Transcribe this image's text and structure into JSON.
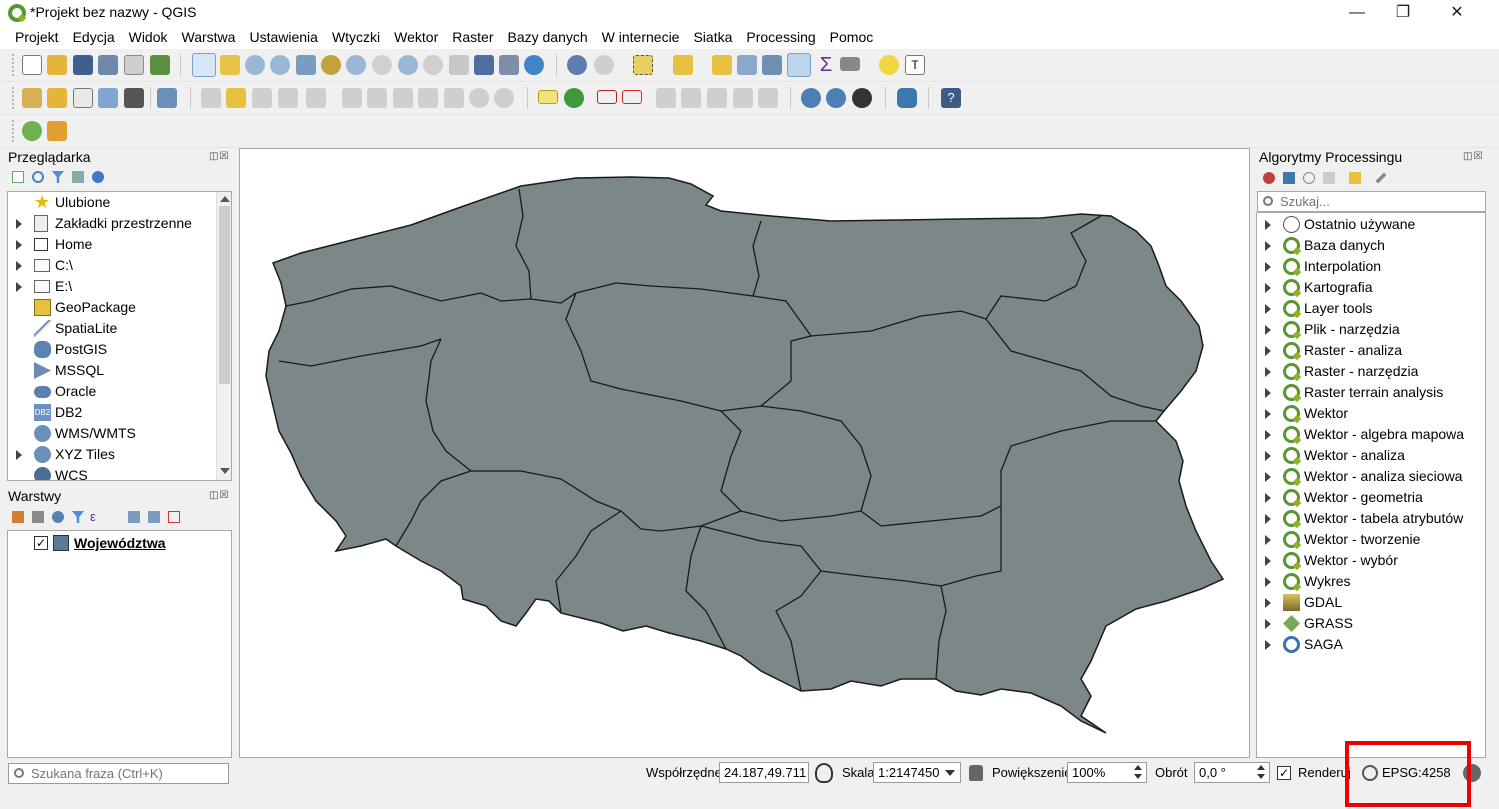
{
  "window": {
    "title": "*Projekt bez nazwy - QGIS",
    "minimize": "—",
    "maximize": "❐",
    "close": "✕"
  },
  "menu": [
    "Projekt",
    "Edycja",
    "Widok",
    "Warstwa",
    "Ustawienia",
    "Wtyczki",
    "Wektor",
    "Raster",
    "Bazy danych",
    "W internecie",
    "Siatka",
    "Processing",
    "Pomoc"
  ],
  "browser": {
    "title": "Przeglądarka",
    "dock_buttons": "◫☒",
    "items": [
      {
        "label": "Ulubione",
        "icon": "star-icon",
        "expandable": false
      },
      {
        "label": "Zakładki przestrzenne",
        "icon": "bookmark-icon",
        "expandable": true
      },
      {
        "label": "Home",
        "icon": "home-icon",
        "expandable": true
      },
      {
        "label": "C:\\",
        "icon": "folder-icon",
        "expandable": true
      },
      {
        "label": "E:\\",
        "icon": "folder-icon",
        "expandable": true
      },
      {
        "label": "GeoPackage",
        "icon": "geopackage-icon",
        "expandable": false
      },
      {
        "label": "SpatiaLite",
        "icon": "spatialite-icon",
        "expandable": false
      },
      {
        "label": "PostGIS",
        "icon": "postgis-icon",
        "expandable": false
      },
      {
        "label": "MSSQL",
        "icon": "mssql-icon",
        "expandable": false
      },
      {
        "label": "Oracle",
        "icon": "oracle-icon",
        "expandable": false
      },
      {
        "label": "DB2",
        "icon": "db2-icon",
        "expandable": false
      },
      {
        "label": "WMS/WMTS",
        "icon": "globe-icon",
        "expandable": false
      },
      {
        "label": "XYZ Tiles",
        "icon": "globe-icon",
        "expandable": true
      },
      {
        "label": "WCS",
        "icon": "globe-icon",
        "expandable": false
      }
    ]
  },
  "layers": {
    "title": "Warstwy",
    "dock_buttons": "◫☒",
    "items": [
      {
        "label": "Województwa",
        "checked": true,
        "check_glyph": "✓",
        "color": "#5b7a99"
      }
    ]
  },
  "processing": {
    "title": "Algorytmy Processingu",
    "dock_buttons": "◫☒",
    "search_placeholder": "Szukaj...",
    "items": [
      {
        "label": "Ostatnio używane",
        "icon": "clock-icon"
      },
      {
        "label": "Baza danych",
        "icon": "qgis-icon"
      },
      {
        "label": "Interpolation",
        "icon": "qgis-icon"
      },
      {
        "label": "Kartografia",
        "icon": "qgis-icon"
      },
      {
        "label": "Layer tools",
        "icon": "qgis-icon"
      },
      {
        "label": "Plik - narzędzia",
        "icon": "qgis-icon"
      },
      {
        "label": "Raster - analiza",
        "icon": "qgis-icon"
      },
      {
        "label": "Raster - narzędzia",
        "icon": "qgis-icon"
      },
      {
        "label": "Raster terrain analysis",
        "icon": "qgis-icon"
      },
      {
        "label": "Wektor",
        "icon": "qgis-icon"
      },
      {
        "label": "Wektor - algebra mapowa",
        "icon": "qgis-icon"
      },
      {
        "label": "Wektor - analiza",
        "icon": "qgis-icon"
      },
      {
        "label": "Wektor - analiza sieciowa",
        "icon": "qgis-icon"
      },
      {
        "label": "Wektor - geometria",
        "icon": "qgis-icon"
      },
      {
        "label": "Wektor - tabela atrybutów",
        "icon": "qgis-icon"
      },
      {
        "label": "Wektor - tworzenie",
        "icon": "qgis-icon"
      },
      {
        "label": "Wektor - wybór",
        "icon": "qgis-icon"
      },
      {
        "label": "Wykres",
        "icon": "qgis-icon"
      },
      {
        "label": "GDAL",
        "icon": "gdal-icon"
      },
      {
        "label": "GRASS",
        "icon": "grass-icon"
      },
      {
        "label": "SAGA",
        "icon": "saga-icon"
      }
    ]
  },
  "statusbar": {
    "search_placeholder": "Szukana fraza (Ctrl+K)",
    "coord_label": "Współrzędne",
    "coord_value": "24.187,49.711",
    "scale_label": "Skala",
    "scale_value": "1:2147450",
    "magnifier_label": "Powiększenie",
    "magnifier_value": "100%",
    "rotation_label": "Obrót",
    "rotation_value": "0,0 °",
    "render_label": "Renderuj",
    "render_check": "✓",
    "crs": "EPSG:4258"
  },
  "colors": {
    "map_fill": "#7b8788",
    "map_stroke": "#1a1a1a",
    "highlight": "#ee0000",
    "qgis_green": "#589632"
  }
}
